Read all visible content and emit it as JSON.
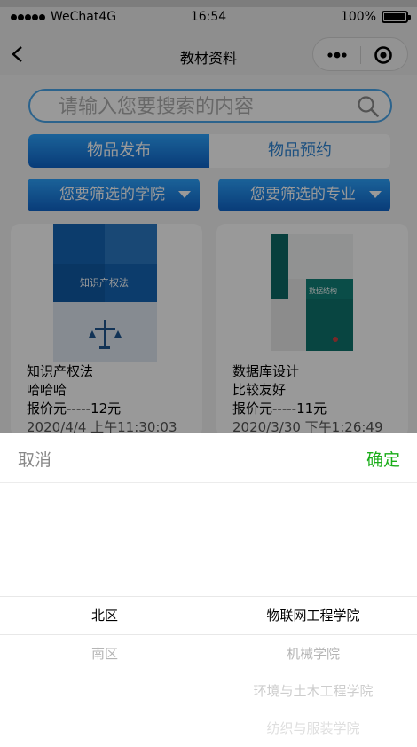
{
  "status_bar": {
    "carrier": "WeChat4G",
    "time": "16:54",
    "battery": "100%"
  },
  "nav": {
    "title": "教材资料",
    "back_icon": "chevron-left-icon",
    "more_icon": "more-dots-icon",
    "close_icon": "target-circle-icon"
  },
  "search": {
    "placeholder": "请输入您要搜索的内容",
    "icon": "search-icon"
  },
  "tabs": [
    {
      "label": "物品发布",
      "active": true
    },
    {
      "label": "物品预约",
      "active": false
    }
  ],
  "filters": {
    "college": "您要筛选的学院",
    "major": "您要筛选的专业"
  },
  "cards": [
    {
      "title": "知识产权法",
      "description": "哈哈哈",
      "price": "报价元-----12元",
      "date": "2020/4/4 上午11:30:03",
      "cover_title": "知识产权法"
    },
    {
      "title": "数据库设计",
      "description": "比较友好",
      "price": "报价元-----11元",
      "date": "2020/3/30 下午1:26:49",
      "cover_title": "数据结构"
    }
  ],
  "picker": {
    "cancel_label": "取消",
    "confirm_label": "确定",
    "campus_options": [
      "北区",
      "南区"
    ],
    "college_options": [
      "物联网工程学院",
      "机械学院",
      "环境与土木工程学院",
      "纺织与服装学院"
    ]
  },
  "colors": {
    "accent_blue": "#1a7be0",
    "confirm_green": "#1aad19",
    "search_border": "#4aa6ea"
  }
}
